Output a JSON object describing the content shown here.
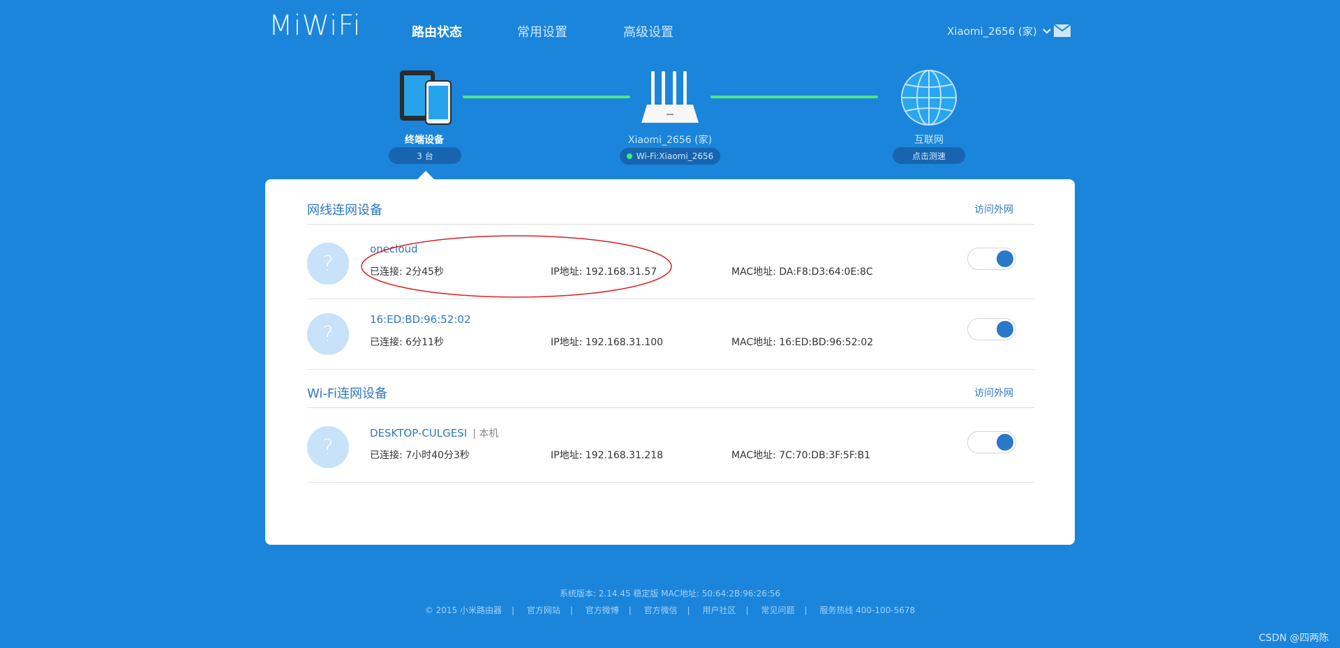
{
  "header": {
    "logo": "MiWiFi",
    "nav": [
      {
        "label": "路由状态",
        "active": true
      },
      {
        "label": "常用设置",
        "active": false
      },
      {
        "label": "高级设置",
        "active": false
      }
    ],
    "router_name": "Xiaomi_2656 (家)",
    "icons": {
      "dropdown": "chevron-down-icon",
      "mail": "mail-icon"
    }
  },
  "topology": {
    "devices": {
      "label": "终端设备",
      "count": "3 台"
    },
    "router": {
      "label": "Xiaomi_2656 (家)",
      "wifi": "Wi-Fi:Xiaomi_2656"
    },
    "internet": {
      "label": "互联网",
      "action": "点击测速"
    },
    "link_color": "#4fe58a"
  },
  "wired": {
    "title": "网线连网设备",
    "link": "访问外网",
    "devices": [
      {
        "name": "onecloud",
        "tag": "",
        "connected": "已连接: 2分45秒",
        "ip": "IP地址: 192.168.31.57",
        "mac": "MAC地址: DA:F8:D3:64:0E:8C",
        "enabled": true
      },
      {
        "name": "16:ED:BD:96:52:02",
        "tag": "",
        "connected": "已连接: 6分11秒",
        "ip": "IP地址: 192.168.31.100",
        "mac": "MAC地址: 16:ED:BD:96:52:02",
        "enabled": true
      }
    ]
  },
  "wifi": {
    "title": "Wi-Fi连网设备",
    "link": "访问外网",
    "devices": [
      {
        "name": "DESKTOP-CULGESI",
        "tag": "| 本机",
        "connected": "已连接: 7小时40分3秒",
        "ip": "IP地址: 192.168.31.218",
        "mac": "MAC地址: 7C:70:DB:3F:5F:B1",
        "enabled": true
      }
    ]
  },
  "footer": {
    "version": "系统版本: 2.14.45 稳定版   MAC地址: 50:64:2B:96:26:56",
    "links": [
      "© 2015 小米路由器",
      "官方网站",
      "官方微博",
      "官方微信",
      "用户社区",
      "常见问题",
      "服务热线 400-100-5678"
    ]
  },
  "watermark": "CSDN @四两陈",
  "colors": {
    "background": "#1a85db",
    "accent": "#2f78c4",
    "annotation": "#d62020"
  }
}
